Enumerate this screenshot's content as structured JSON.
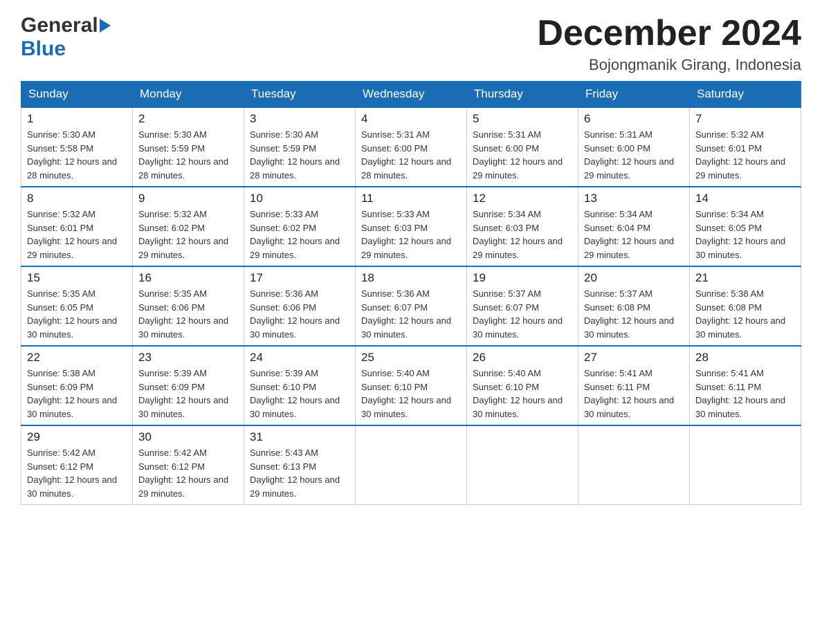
{
  "header": {
    "logo": {
      "general": "General",
      "blue": "Blue",
      "triangle_symbol": "▶"
    },
    "month_title": "December 2024",
    "location": "Bojongmanik Girang, Indonesia"
  },
  "days_of_week": [
    "Sunday",
    "Monday",
    "Tuesday",
    "Wednesday",
    "Thursday",
    "Friday",
    "Saturday"
  ],
  "weeks": [
    [
      {
        "day": "1",
        "sunrise": "5:30 AM",
        "sunset": "5:58 PM",
        "daylight": "12 hours and 28 minutes."
      },
      {
        "day": "2",
        "sunrise": "5:30 AM",
        "sunset": "5:59 PM",
        "daylight": "12 hours and 28 minutes."
      },
      {
        "day": "3",
        "sunrise": "5:30 AM",
        "sunset": "5:59 PM",
        "daylight": "12 hours and 28 minutes."
      },
      {
        "day": "4",
        "sunrise": "5:31 AM",
        "sunset": "6:00 PM",
        "daylight": "12 hours and 28 minutes."
      },
      {
        "day": "5",
        "sunrise": "5:31 AM",
        "sunset": "6:00 PM",
        "daylight": "12 hours and 29 minutes."
      },
      {
        "day": "6",
        "sunrise": "5:31 AM",
        "sunset": "6:00 PM",
        "daylight": "12 hours and 29 minutes."
      },
      {
        "day": "7",
        "sunrise": "5:32 AM",
        "sunset": "6:01 PM",
        "daylight": "12 hours and 29 minutes."
      }
    ],
    [
      {
        "day": "8",
        "sunrise": "5:32 AM",
        "sunset": "6:01 PM",
        "daylight": "12 hours and 29 minutes."
      },
      {
        "day": "9",
        "sunrise": "5:32 AM",
        "sunset": "6:02 PM",
        "daylight": "12 hours and 29 minutes."
      },
      {
        "day": "10",
        "sunrise": "5:33 AM",
        "sunset": "6:02 PM",
        "daylight": "12 hours and 29 minutes."
      },
      {
        "day": "11",
        "sunrise": "5:33 AM",
        "sunset": "6:03 PM",
        "daylight": "12 hours and 29 minutes."
      },
      {
        "day": "12",
        "sunrise": "5:34 AM",
        "sunset": "6:03 PM",
        "daylight": "12 hours and 29 minutes."
      },
      {
        "day": "13",
        "sunrise": "5:34 AM",
        "sunset": "6:04 PM",
        "daylight": "12 hours and 29 minutes."
      },
      {
        "day": "14",
        "sunrise": "5:34 AM",
        "sunset": "6:05 PM",
        "daylight": "12 hours and 30 minutes."
      }
    ],
    [
      {
        "day": "15",
        "sunrise": "5:35 AM",
        "sunset": "6:05 PM",
        "daylight": "12 hours and 30 minutes."
      },
      {
        "day": "16",
        "sunrise": "5:35 AM",
        "sunset": "6:06 PM",
        "daylight": "12 hours and 30 minutes."
      },
      {
        "day": "17",
        "sunrise": "5:36 AM",
        "sunset": "6:06 PM",
        "daylight": "12 hours and 30 minutes."
      },
      {
        "day": "18",
        "sunrise": "5:36 AM",
        "sunset": "6:07 PM",
        "daylight": "12 hours and 30 minutes."
      },
      {
        "day": "19",
        "sunrise": "5:37 AM",
        "sunset": "6:07 PM",
        "daylight": "12 hours and 30 minutes."
      },
      {
        "day": "20",
        "sunrise": "5:37 AM",
        "sunset": "6:08 PM",
        "daylight": "12 hours and 30 minutes."
      },
      {
        "day": "21",
        "sunrise": "5:38 AM",
        "sunset": "6:08 PM",
        "daylight": "12 hours and 30 minutes."
      }
    ],
    [
      {
        "day": "22",
        "sunrise": "5:38 AM",
        "sunset": "6:09 PM",
        "daylight": "12 hours and 30 minutes."
      },
      {
        "day": "23",
        "sunrise": "5:39 AM",
        "sunset": "6:09 PM",
        "daylight": "12 hours and 30 minutes."
      },
      {
        "day": "24",
        "sunrise": "5:39 AM",
        "sunset": "6:10 PM",
        "daylight": "12 hours and 30 minutes."
      },
      {
        "day": "25",
        "sunrise": "5:40 AM",
        "sunset": "6:10 PM",
        "daylight": "12 hours and 30 minutes."
      },
      {
        "day": "26",
        "sunrise": "5:40 AM",
        "sunset": "6:10 PM",
        "daylight": "12 hours and 30 minutes."
      },
      {
        "day": "27",
        "sunrise": "5:41 AM",
        "sunset": "6:11 PM",
        "daylight": "12 hours and 30 minutes."
      },
      {
        "day": "28",
        "sunrise": "5:41 AM",
        "sunset": "6:11 PM",
        "daylight": "12 hours and 30 minutes."
      }
    ],
    [
      {
        "day": "29",
        "sunrise": "5:42 AM",
        "sunset": "6:12 PM",
        "daylight": "12 hours and 30 minutes."
      },
      {
        "day": "30",
        "sunrise": "5:42 AM",
        "sunset": "6:12 PM",
        "daylight": "12 hours and 29 minutes."
      },
      {
        "day": "31",
        "sunrise": "5:43 AM",
        "sunset": "6:13 PM",
        "daylight": "12 hours and 29 minutes."
      },
      null,
      null,
      null,
      null
    ]
  ],
  "labels": {
    "sunrise": "Sunrise:",
    "sunset": "Sunset:",
    "daylight": "Daylight:"
  }
}
